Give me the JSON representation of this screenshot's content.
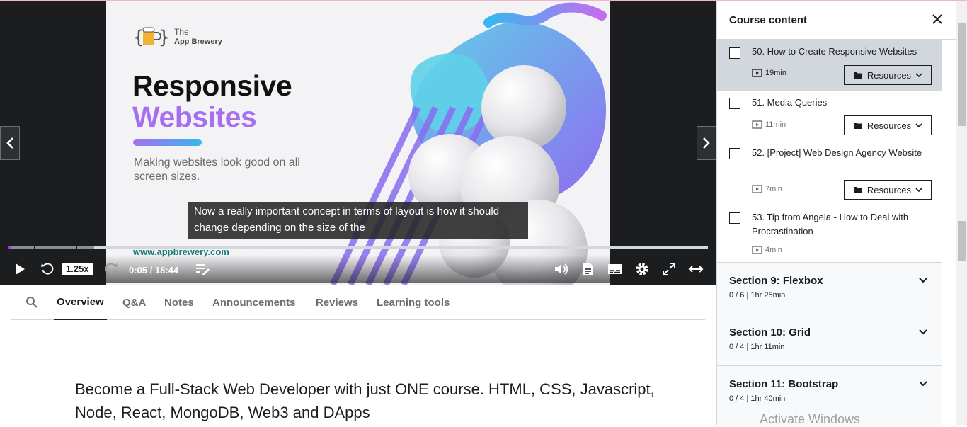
{
  "video": {
    "slide": {
      "logo_line1": "The",
      "logo_line2": "App Brewery",
      "title_line1": "Responsive",
      "title_line2": "Websites",
      "subtitle": "Making websites look good on all screen sizes.",
      "url": "www.appbrewery.com"
    },
    "caption": "Now a really important concept in terms of layout is how it should change depending on the size of the",
    "progress_fraction": 0.0045,
    "speed": "1.25x",
    "time": "0:05 / 18:44"
  },
  "tabs": [
    {
      "label": "Overview",
      "active": true
    },
    {
      "label": "Q&A"
    },
    {
      "label": "Notes"
    },
    {
      "label": "Announcements"
    },
    {
      "label": "Reviews"
    },
    {
      "label": "Learning tools"
    }
  ],
  "overview": {
    "headline": "Become a Full-Stack Web Developer with just ONE course. HTML, CSS, Javascript, Node, React, MongoDB, Web3 and DApps"
  },
  "sidebar": {
    "title": "Course content",
    "lectures": [
      {
        "title": "50. How to Create Responsive Websites",
        "duration": "19min",
        "resources": "Resources",
        "current": true
      },
      {
        "title": "51. Media Queries",
        "duration": "11min",
        "resources": "Resources"
      },
      {
        "title": "52. [Project] Web Design Agency Website",
        "duration": "7min",
        "resources": "Resources"
      },
      {
        "title": "53. Tip from Angela - How to Deal with Procrastination",
        "duration": "4min"
      }
    ],
    "sections": [
      {
        "title": "Section 9: Flexbox",
        "meta": "0 / 6 | 1hr 25min"
      },
      {
        "title": "Section 10: Grid",
        "meta": "0 / 4 | 1hr 11min"
      },
      {
        "title": "Section 11: Bootstrap",
        "meta": "0 / 4 | 1hr 40min"
      }
    ]
  },
  "watermark": "Activate Windows",
  "colors": {
    "accent": "#a435f0",
    "dark": "#1c1d1f",
    "current_row": "#d1d7dc"
  }
}
